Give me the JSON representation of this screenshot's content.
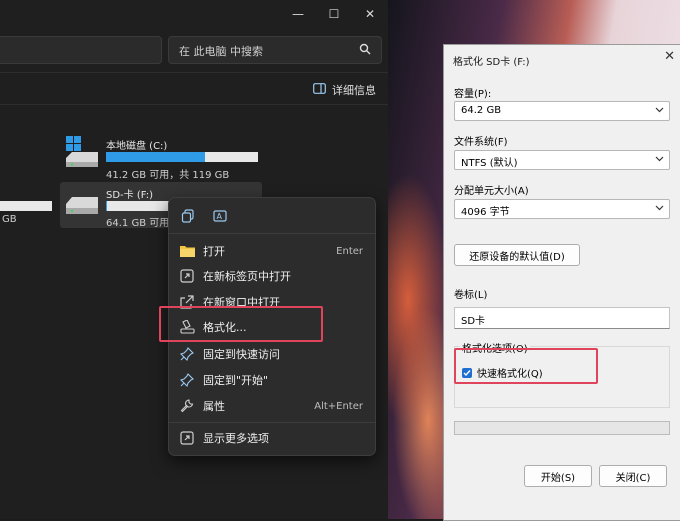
{
  "explorer": {
    "search_placeholder": "在 此电脑 中搜索",
    "details_label": "详细信息",
    "window_controls": {
      "minimize": "—",
      "maximize": "☐",
      "close": "✕"
    },
    "drives": [
      {
        "name": "本地磁盘 (C:)",
        "info": "41.2 GB 可用，共 119 GB",
        "used_fraction": 0.65
      },
      {
        "name": "SD-卡 (F:)",
        "info": "64.1 GB 可用，",
        "used_fraction": 0.02
      }
    ],
    "partial_drive_info": "GB"
  },
  "context_menu": {
    "items": [
      {
        "label": "打开",
        "shortcut": "Enter",
        "icon": "folder-icon"
      },
      {
        "label": "在新标签页中打开",
        "shortcut": "",
        "icon": "open-new-tab-icon"
      },
      {
        "label": "在新窗口中打开",
        "shortcut": "",
        "icon": "open-new-window-icon"
      },
      {
        "label": "格式化...",
        "shortcut": "",
        "icon": "format-icon"
      },
      {
        "label": "固定到快速访问",
        "shortcut": "",
        "icon": "pin-icon"
      },
      {
        "label": "固定到\"开始\"",
        "shortcut": "",
        "icon": "pin-icon"
      },
      {
        "label": "属性",
        "shortcut": "Alt+Enter",
        "icon": "wrench-icon"
      },
      {
        "label": "显示更多选项",
        "shortcut": "",
        "icon": "more-options-icon"
      }
    ]
  },
  "format_dialog": {
    "title": "格式化 SD卡 (F:)",
    "capacity_label": "容量(P):",
    "capacity_value": "64.2 GB",
    "filesystem_label": "文件系统(F)",
    "filesystem_value": "NTFS (默认)",
    "allocation_label": "分配单元大小(A)",
    "allocation_value": "4096 字节",
    "restore_defaults_button": "还原设备的默认值(D)",
    "volume_label": "卷标(L)",
    "volume_value": "SD卡",
    "options_group_label": "格式化选项(O)",
    "quick_format_label": "快速格式化(Q)",
    "quick_format_checked": true,
    "start_button": "开始(S)",
    "close_button": "关闭(C)"
  },
  "colors": {
    "highlight": "#e0435c",
    "accent": "#2f9be6",
    "checkbox": "#1f6fd1"
  }
}
